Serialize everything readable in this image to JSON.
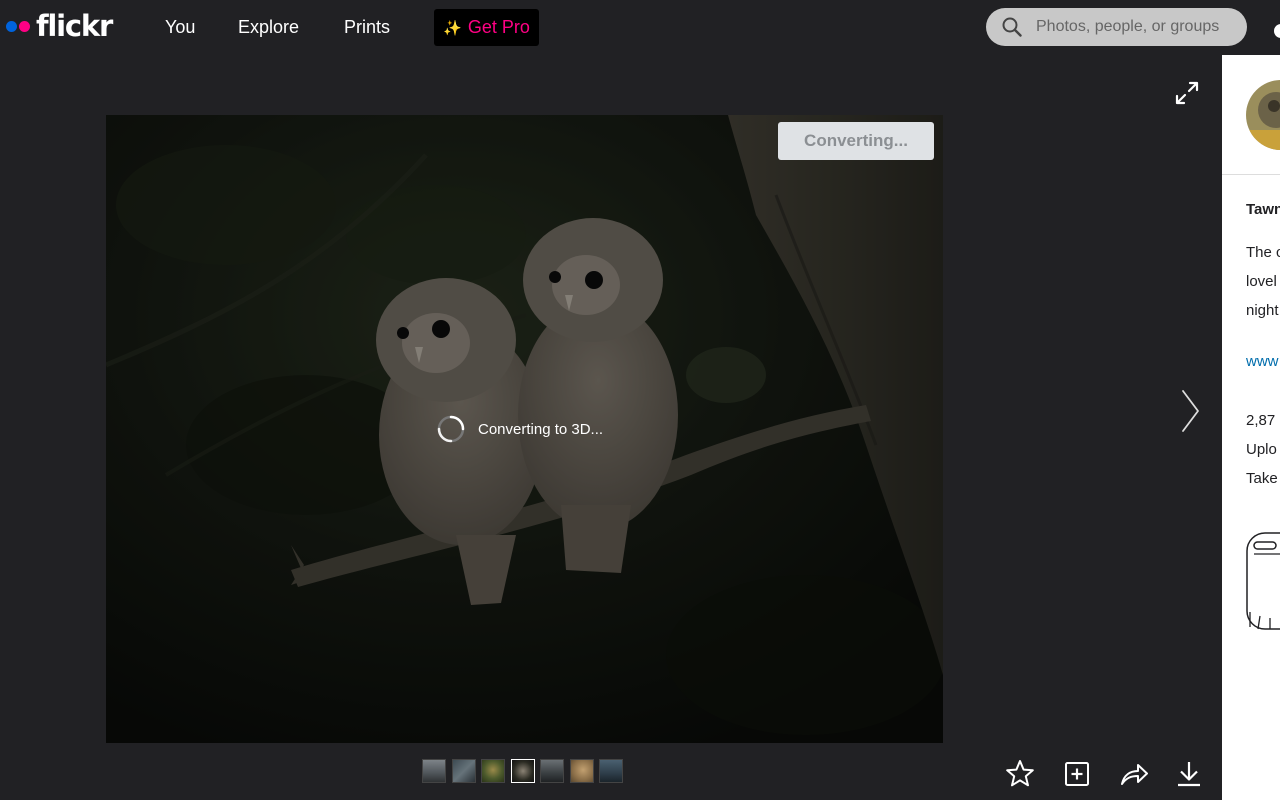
{
  "header": {
    "logo_text": "flickr",
    "nav": [
      {
        "label": "You"
      },
      {
        "label": "Explore"
      },
      {
        "label": "Prints"
      }
    ],
    "get_pro": {
      "icon": "sparkles-icon",
      "label": "Get Pro"
    },
    "search": {
      "placeholder": "Photos, people, or groups"
    }
  },
  "viewer": {
    "convert_button_label": "Converting...",
    "status_text": "Converting to 3D...",
    "thumbnail_count": 7,
    "active_thumbnail_index": 3
  },
  "info_panel": {
    "title": "Tawn",
    "description_lines": [
      "The c",
      "lovel",
      "night"
    ],
    "link_text": "www",
    "stats_lines": [
      "2,87",
      "Uplo",
      "Take"
    ]
  },
  "colors": {
    "background": "#212124",
    "brand_blue": "#0063dc",
    "brand_pink": "#ff0084",
    "link_blue": "#006dac"
  }
}
